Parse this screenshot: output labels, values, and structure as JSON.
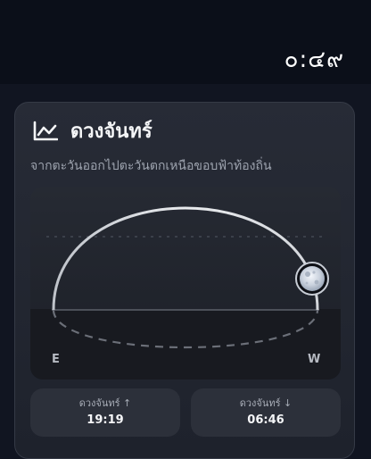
{
  "status_bar": {
    "time": "๐:๔๙"
  },
  "moon_card": {
    "icon": "line-chart-icon",
    "title": "ดวงจันทร์",
    "subtitle": "จากตะวันออกไปตะวันตกเหนือขอบฟ้าท้องถิ่น",
    "east_label": "E",
    "west_label": "W",
    "moon_icon": "moon-icon",
    "moonrise": {
      "label": "ดวงจันทร์ ↑",
      "time": "19:19"
    },
    "moonset": {
      "label": "ดวงจันทร์ ↓",
      "time": "06:46"
    }
  },
  "colors": {
    "background": "#111521",
    "card": "#232732",
    "tile": "#2c303a",
    "text_primary": "#f4f5f7",
    "text_secondary": "#9da3ae"
  }
}
